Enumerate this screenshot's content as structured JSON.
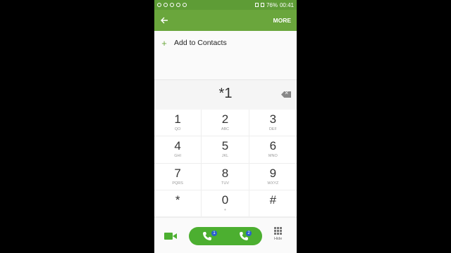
{
  "statusbar": {
    "battery": "76%",
    "time": "00:41"
  },
  "appbar": {
    "more_label": "MORE"
  },
  "add_contacts": {
    "label": "Add to Contacts"
  },
  "dialer": {
    "number": "*1"
  },
  "keys": [
    {
      "digit": "1",
      "letters": "QO"
    },
    {
      "digit": "2",
      "letters": "ABC"
    },
    {
      "digit": "3",
      "letters": "DEF"
    },
    {
      "digit": "4",
      "letters": "GHI"
    },
    {
      "digit": "5",
      "letters": "JKL"
    },
    {
      "digit": "6",
      "letters": "MNO"
    },
    {
      "digit": "7",
      "letters": "PQRS"
    },
    {
      "digit": "8",
      "letters": "TUV"
    },
    {
      "digit": "9",
      "letters": "WXYZ"
    },
    {
      "digit": "*",
      "letters": ""
    },
    {
      "digit": "0",
      "letters": "+"
    },
    {
      "digit": "#",
      "letters": ""
    }
  ],
  "bottom": {
    "sim1_label": "1",
    "sim2_label": "2",
    "hide_label": "Hide"
  },
  "colors": {
    "accent": "#6aa63c",
    "call": "#4caf30"
  },
  "icons": {
    "back": "arrow-left-icon",
    "backspace": "backspace-icon",
    "video": "video-call-icon",
    "call": "phone-icon",
    "hide": "keypad-grid-icon"
  }
}
